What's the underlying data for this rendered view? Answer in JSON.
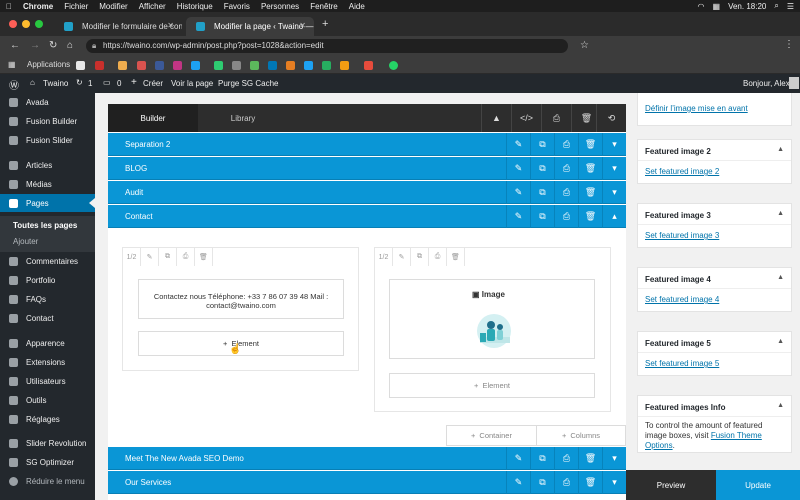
{
  "macbar": {
    "app": "Chrome",
    "menus": [
      "Fichier",
      "Modifier",
      "Afficher",
      "Historique",
      "Favoris",
      "Personnes",
      "Fenêtre",
      "Aide"
    ],
    "clock": "Ven. 18:20"
  },
  "tabs": [
    {
      "label": "Modifier le formulaire de conta"
    },
    {
      "label": "Modifier la page ‹ Twaino — W"
    }
  ],
  "address": {
    "url": "https://twaino.com/wp-admin/post.php?post=1028&action=edit"
  },
  "bookmarks": {
    "apps_label": "Applications"
  },
  "wpbar": {
    "site": "Twaino",
    "updates": "1",
    "comments": "0",
    "new": "Créer",
    "view": "Voir la page",
    "purge": "Purge SG Cache",
    "greeting": "Bonjour, Alex"
  },
  "sidebar": {
    "items": [
      {
        "label": "Avada"
      },
      {
        "label": "Fusion Builder"
      },
      {
        "label": "Fusion Slider"
      },
      {
        "label": "Articles"
      },
      {
        "label": "Médias"
      },
      {
        "label": "Pages"
      },
      {
        "label": "Commentaires"
      },
      {
        "label": "Portfolio"
      },
      {
        "label": "FAQs"
      },
      {
        "label": "Contact"
      },
      {
        "label": "Apparence"
      },
      {
        "label": "Extensions"
      },
      {
        "label": "Utilisateurs"
      },
      {
        "label": "Outils"
      },
      {
        "label": "Réglages"
      },
      {
        "label": "Slider Revolution"
      },
      {
        "label": "SG Optimizer"
      },
      {
        "label": "Réduire le menu"
      }
    ],
    "submenu": [
      "Toutes les pages",
      "Ajouter"
    ]
  },
  "builder": {
    "tab_builder": "Builder",
    "tab_library": "Library",
    "sections": [
      {
        "label": "Separation 2"
      },
      {
        "label": "BLOG"
      },
      {
        "label": "Audit"
      },
      {
        "label": "Contact"
      },
      {
        "label": "Meet The New Avada SEO Demo"
      },
      {
        "label": "Our Services"
      }
    ],
    "col_left": {
      "size": "1/2",
      "text": "Contactez nous Téléphone: +33 7 86 07 39 48 Mail : contact@twaino.com",
      "add_element": "Element"
    },
    "col_right": {
      "size": "1/2",
      "image_label": "Image",
      "add_element": "Element"
    },
    "add_container": "Container",
    "add_columns": "Columns"
  },
  "right_panel": {
    "top_link": "Définir l’image mise en avant",
    "boxes": [
      {
        "title": "Featured image 2",
        "link": "Set featured image 2"
      },
      {
        "title": "Featured image 3",
        "link": "Set featured image 3"
      },
      {
        "title": "Featured image 4",
        "link": "Set featured image 4"
      },
      {
        "title": "Featured image 5",
        "link": "Set featured image 5"
      }
    ],
    "info": {
      "title": "Featured images Info",
      "text": "To control the amount of featured image boxes, visit",
      "link": "Fusion Theme Options",
      "end": "."
    },
    "preview": "Preview",
    "update": "Update"
  },
  "colors": {
    "accent": "#0a96d6",
    "wp_dark": "#23282d",
    "wp_blue": "#0073aa"
  }
}
